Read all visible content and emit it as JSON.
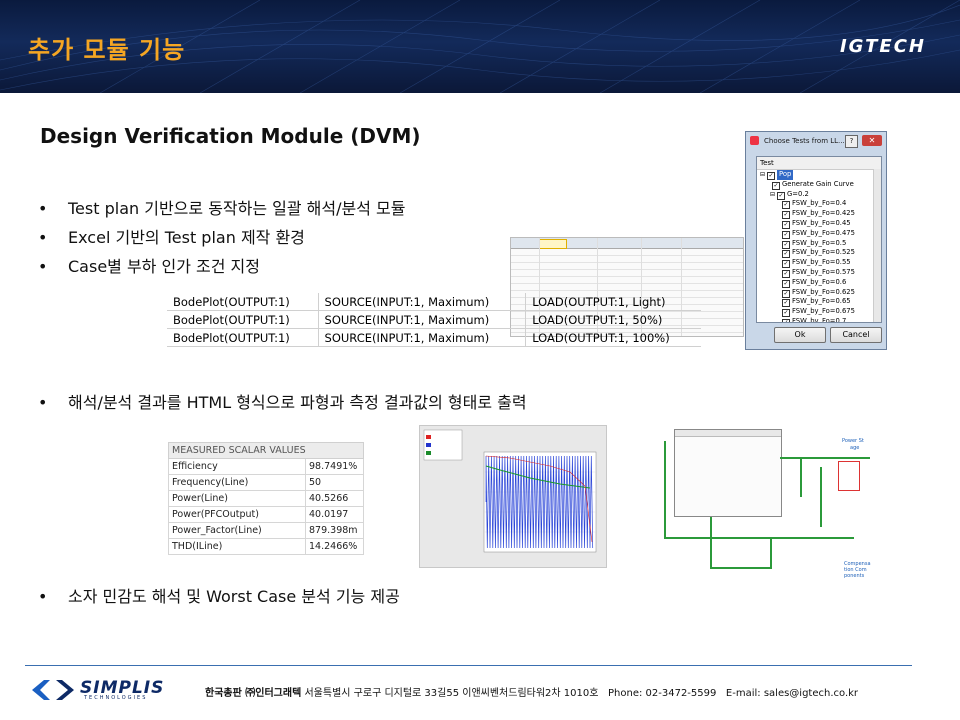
{
  "header": {
    "title": "추가 모듈 기능",
    "brand": "IGTECH",
    "title_color": "#f5a623",
    "background": "#0e1f48"
  },
  "subtitle": "Design Verification Module (DVM)",
  "bullets_top": [
    "Test plan 기반으로 동작하는 일괄 해석/분석 모듈",
    "Excel 기반의 Test plan 제작 환경",
    "Case별 부하 인가 조건 지정"
  ],
  "bullets_mid": [
    "해석/분석 결과를 HTML 형식으로 파형과 측정 결과값의 형태로 출력"
  ],
  "bullets_bottom": [
    "소자 민감도 해석 및 Worst Case 분석 기능 제공"
  ],
  "load_table": [
    [
      "BodePlot(OUTPUT:1)",
      "SOURCE(INPUT:1, Maximum)",
      "LOAD(OUTPUT:1, Light)"
    ],
    [
      "BodePlot(OUTPUT:1)",
      "SOURCE(INPUT:1, Maximum)",
      "LOAD(OUTPUT:1, 50%)"
    ],
    [
      "BodePlot(OUTPUT:1)",
      "SOURCE(INPUT:1, Maximum)",
      "LOAD(OUTPUT:1, 100%)"
    ]
  ],
  "dialog": {
    "title": "Choose Tests from LL...",
    "column": "Test",
    "items": [
      {
        "label": "Pop",
        "indent": 0,
        "selected": true
      },
      {
        "label": "Generate Gain Curve",
        "indent": 1
      },
      {
        "label": "G=0.2",
        "indent": 1
      },
      {
        "label": "FSW_by_Fo=0.4",
        "indent": 2
      },
      {
        "label": "FSW_by_Fo=0.425",
        "indent": 2
      },
      {
        "label": "FSW_by_Fo=0.45",
        "indent": 2
      },
      {
        "label": "FSW_by_Fo=0.475",
        "indent": 2
      },
      {
        "label": "FSW_by_Fo=0.5",
        "indent": 2
      },
      {
        "label": "FSW_by_Fo=0.525",
        "indent": 2
      },
      {
        "label": "FSW_by_Fo=0.55",
        "indent": 2
      },
      {
        "label": "FSW_by_Fo=0.575",
        "indent": 2
      },
      {
        "label": "FSW_by_Fo=0.6",
        "indent": 2
      },
      {
        "label": "FSW_by_Fo=0.625",
        "indent": 2
      },
      {
        "label": "FSW_by_Fo=0.65",
        "indent": 2
      },
      {
        "label": "FSW_by_Fo=0.675",
        "indent": 2
      },
      {
        "label": "FSW_by_Fo=0.7",
        "indent": 2
      }
    ],
    "ok": "Ok",
    "cancel": "Cancel"
  },
  "scalar_table": {
    "header": "MEASURED SCALAR VALUES",
    "rows": [
      [
        "Efficiency",
        "98.7491%"
      ],
      [
        "Frequency(Line)",
        "50"
      ],
      [
        "Power(Line)",
        "40.5266"
      ],
      [
        "Power(PFCOutput)",
        "40.0197"
      ],
      [
        "Power_Factor(Line)",
        "879.398m"
      ],
      [
        "THD(ILine)",
        "14.2466%"
      ]
    ]
  },
  "schematic": {
    "labels": [
      "Power St",
      "age",
      "Compensa",
      "tion Com",
      "ponents"
    ]
  },
  "footer": {
    "logo": "SIMPLIS",
    "logo_sub": "TECHNOLOGIES",
    "company": "한국총판 ㈜인터그래텍",
    "address": "서울특별시 구로구 디지털로 33길55 이앤씨벤처드림타워2차 1010호",
    "phone": "Phone: 02-3472-5599",
    "email": "E-mail: sales@igtech.co.kr"
  }
}
